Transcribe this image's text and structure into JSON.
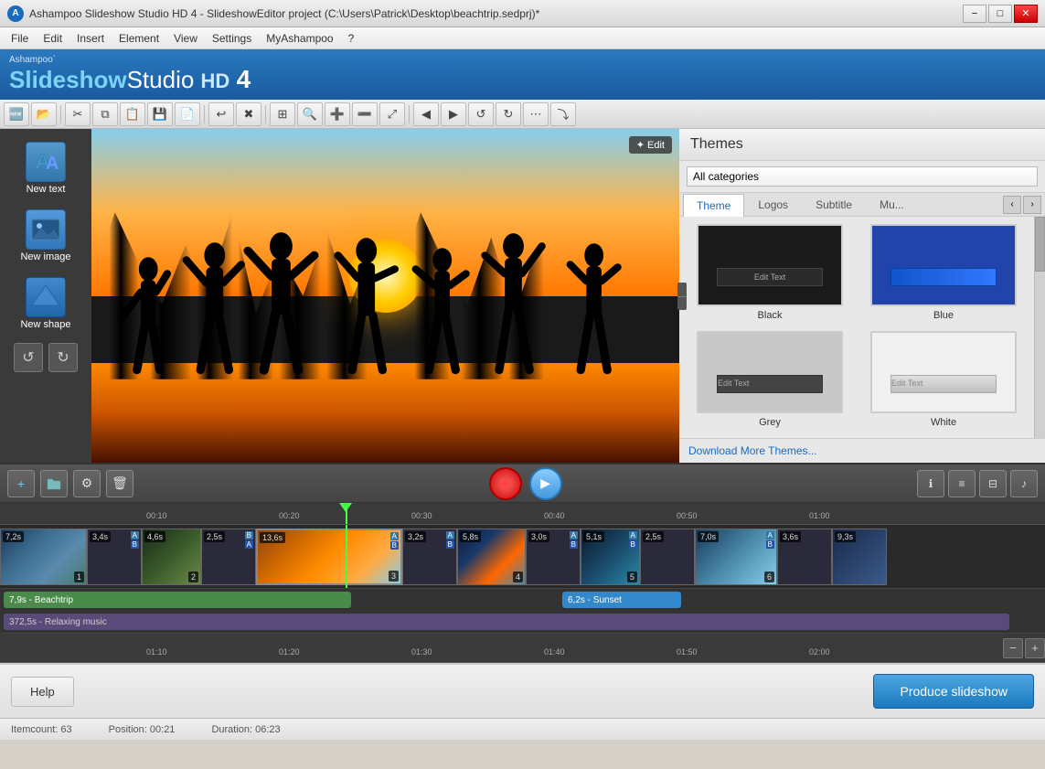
{
  "window": {
    "title": "Ashampoo Slideshow Studio HD 4 - SlideshowEditor project (C:\\Users\\Patrick\\Desktop\\beachtrip.sedprj)*",
    "icon": "A"
  },
  "titlebar": {
    "minimize": "−",
    "maximize": "□",
    "close": "✕"
  },
  "menu": {
    "items": [
      "File",
      "Edit",
      "Insert",
      "Element",
      "View",
      "Settings",
      "MyAshampoo",
      "?"
    ]
  },
  "applogo": {
    "brand": "Ashampoo´",
    "main1": "Slideshow",
    "main2": "Studio",
    "hd": "HD",
    "num": "4"
  },
  "toolbar": {
    "buttons": [
      "new",
      "open",
      "cut",
      "copy",
      "paste",
      "save",
      "saveas",
      "undo",
      "redo",
      "delete",
      "view1",
      "view2",
      "zoomin",
      "zoomout",
      "fit",
      "prev",
      "next",
      "rotate-ccw",
      "rotate-cw",
      "more1",
      "more2"
    ]
  },
  "leftpanel": {
    "new_text": "New text",
    "new_image": "New image",
    "new_shape": "New shape"
  },
  "preview": {
    "edit_label": "✦ Edit"
  },
  "themes": {
    "title": "Themes",
    "categories_label": "All categories",
    "tabs": [
      "Theme",
      "Logos",
      "Subtitle",
      "Mu..."
    ],
    "items": [
      {
        "name": "Black",
        "style": "black"
      },
      {
        "name": "Blue",
        "style": "blue"
      },
      {
        "name": "Grey",
        "style": "grey"
      },
      {
        "name": "White",
        "style": "white"
      }
    ],
    "download_link": "Download More Themes..."
  },
  "timeline": {
    "add_btn": "+",
    "folder_btn": "📁",
    "settings_btn": "⚙",
    "delete_btn": "🗑",
    "ruler_marks": [
      "00:10",
      "00:20",
      "00:30",
      "00:40",
      "00:50",
      "01:00"
    ],
    "ruler_marks2": [
      "01:10",
      "01:20",
      "01:30",
      "01:40",
      "01:50",
      "02:00"
    ],
    "clips": [
      {
        "duration": "7,2s",
        "num": "1",
        "ab": true
      },
      {
        "duration": "3,4s",
        "num": "",
        "ab": true
      },
      {
        "duration": "4,6s",
        "num": "2",
        "ab": false
      },
      {
        "duration": "2,5s",
        "num": "",
        "ab": true
      },
      {
        "duration": "13,6s",
        "num": "3",
        "ab": true
      },
      {
        "duration": "3,2s",
        "num": "",
        "ab": true
      },
      {
        "duration": "5,8s",
        "num": "4",
        "ab": false
      },
      {
        "duration": "3,0s",
        "num": "",
        "ab": true
      },
      {
        "duration": "5,1s",
        "num": "5",
        "ab": true
      },
      {
        "duration": "2,5s",
        "num": "",
        "ab": false
      },
      {
        "duration": "7,0s",
        "num": "6",
        "ab": true
      },
      {
        "duration": "3,6s",
        "num": "",
        "ab": false
      },
      {
        "duration": "9,3s",
        "num": "",
        "ab": false
      }
    ],
    "tracks": {
      "beachtrip": "7,9s - Beachtrip",
      "sunset": "6,2s - Sunset",
      "music": "372,5s - Relaxing music"
    },
    "info_btns": [
      "ℹ",
      "≡",
      "⊟",
      "♪"
    ]
  },
  "bottom": {
    "help_label": "Help",
    "produce_label": "Produce slideshow"
  },
  "statusbar": {
    "itemcount": "Itemcount: 63",
    "position": "Position: 00:21",
    "duration": "Duration: 06:23"
  }
}
